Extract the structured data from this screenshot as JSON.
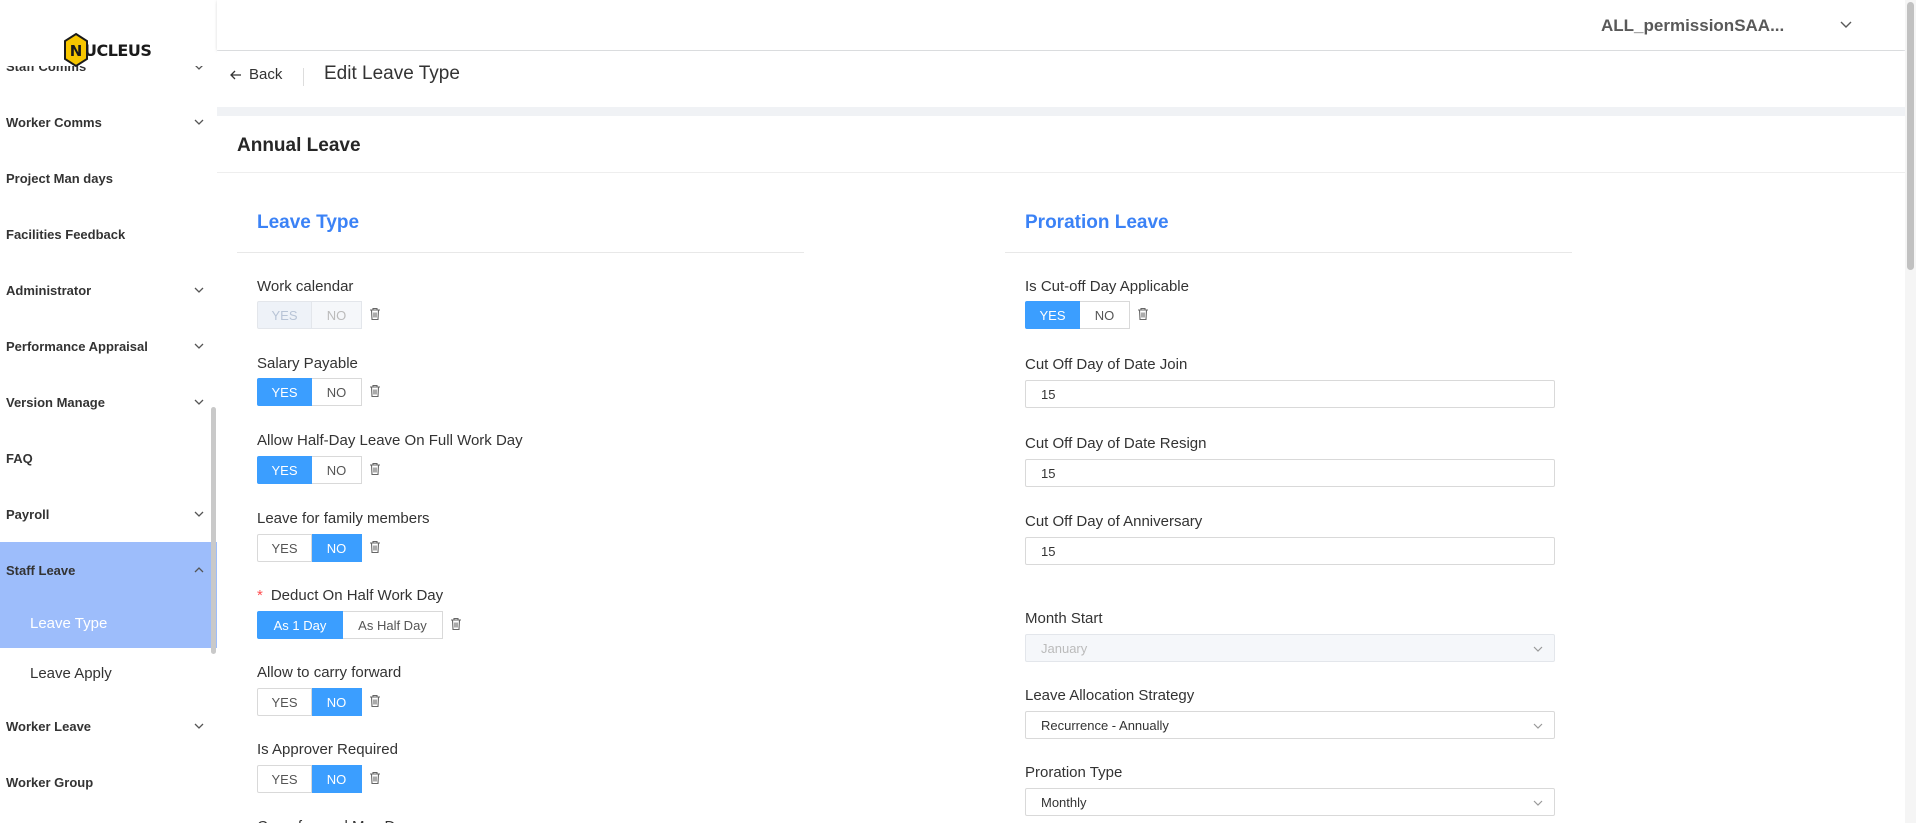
{
  "sidebar": {
    "logo_text": "UCLEUS",
    "logo_letter": "N",
    "items": [
      {
        "label": "Staff Comms",
        "has_chevron": true
      },
      {
        "label": "Worker Comms",
        "has_chevron": true
      },
      {
        "label": "Project Man days",
        "has_chevron": false
      },
      {
        "label": "Facilities Feedback",
        "has_chevron": false
      },
      {
        "label": "Administrator",
        "has_chevron": true
      },
      {
        "label": "Performance Appraisal",
        "has_chevron": true
      },
      {
        "label": "Version Manage",
        "has_chevron": true
      },
      {
        "label": "FAQ",
        "has_chevron": false
      },
      {
        "label": "Payroll",
        "has_chevron": true
      },
      {
        "label": "Staff Leave",
        "has_chevron": true,
        "expanded": true
      },
      {
        "label": "Worker Leave",
        "has_chevron": true
      },
      {
        "label": "Worker Group",
        "has_chevron": false
      }
    ],
    "staff_leave_sub": [
      {
        "label": "Leave Type",
        "active": true
      },
      {
        "label": "Leave Apply",
        "active": false
      }
    ]
  },
  "header": {
    "user_name": "ALL_permissionSAA..."
  },
  "page": {
    "back_label": "Back",
    "title": "Edit Leave Type"
  },
  "card": {
    "title": "Annual Leave"
  },
  "leave_type": {
    "section_title": "Leave Type",
    "fields": {
      "work_calendar": {
        "label": "Work calendar",
        "yes": "YES",
        "no": "NO"
      },
      "salary_payable": {
        "label": "Salary Payable",
        "yes": "YES",
        "no": "NO"
      },
      "half_day": {
        "label": "Allow Half-Day Leave On Full Work Day",
        "yes": "YES",
        "no": "NO"
      },
      "family": {
        "label": "Leave for family members",
        "yes": "YES",
        "no": "NO"
      },
      "deduct": {
        "label": "Deduct On Half Work Day",
        "required": "*",
        "opt1": "As 1 Day",
        "opt2": "As Half Day"
      },
      "carry": {
        "label": "Allow to carry forward",
        "yes": "YES",
        "no": "NO"
      },
      "approver": {
        "label": "Is Approver Required",
        "yes": "YES",
        "no": "NO"
      }
    },
    "cut_off_label": "Carry forward Max Days"
  },
  "proration": {
    "section_title": "Proration Leave",
    "cutoff_applicable": {
      "label": "Is Cut-off Day Applicable",
      "yes": "YES",
      "no": "NO"
    },
    "cutoff_join": {
      "label": "Cut Off Day of Date Join",
      "value": "15"
    },
    "cutoff_resign": {
      "label": "Cut Off Day of Date Resign",
      "value": "15"
    },
    "cutoff_anniv": {
      "label": "Cut Off Day of Anniversary",
      "value": "15"
    },
    "month_start": {
      "label": "Month Start",
      "value": "January"
    },
    "strategy": {
      "label": "Leave Allocation Strategy",
      "value": "Recurrence - Annually"
    },
    "proration_type": {
      "label": "Proration Type",
      "value": "Monthly"
    }
  },
  "colors": {
    "accent": "#3b9eff",
    "section_title": "#3b82f6",
    "sidebar_active": "#9dbdfb"
  }
}
